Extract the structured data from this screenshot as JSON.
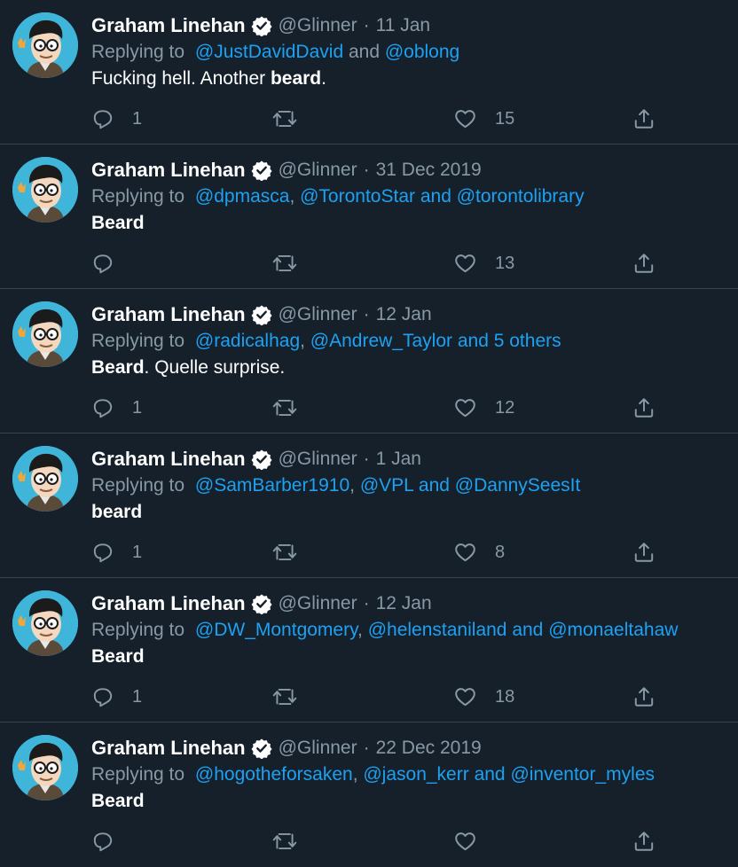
{
  "tweets": [
    {
      "name": "Graham Linehan",
      "handle": "@Glinner",
      "separator": "·",
      "date": "11 Jan",
      "replying_prefix": "Replying to",
      "replying_parts": [
        {
          "t": "@JustDavidDavid",
          "link": true
        },
        {
          "t": " and ",
          "link": false
        },
        {
          "t": "@oblong",
          "link": true
        }
      ],
      "text_parts": [
        {
          "t": "Fucking hell. Another ",
          "bold": false
        },
        {
          "t": "beard",
          "bold": true
        },
        {
          "t": ".",
          "bold": false
        }
      ],
      "replies": "1",
      "retweets": "",
      "likes": "15"
    },
    {
      "name": "Graham Linehan",
      "handle": "@Glinner",
      "separator": "·",
      "date": "31 Dec 2019",
      "replying_prefix": "Replying to",
      "replying_parts": [
        {
          "t": "@dpmasca",
          "link": true
        },
        {
          "t": ", ",
          "link": false
        },
        {
          "t": "@TorontoStar",
          "link": true
        },
        {
          "t": " and ",
          "link": true
        },
        {
          "t": "@torontolibrary",
          "link": true
        }
      ],
      "text_parts": [
        {
          "t": "Beard",
          "bold": true
        }
      ],
      "replies": "",
      "retweets": "",
      "likes": "13"
    },
    {
      "name": "Graham Linehan",
      "handle": "@Glinner",
      "separator": "·",
      "date": "12 Jan",
      "replying_prefix": "Replying to",
      "replying_parts": [
        {
          "t": "@radicalhag",
          "link": true
        },
        {
          "t": ", ",
          "link": false
        },
        {
          "t": "@Andrew_Taylor",
          "link": true
        },
        {
          "t": " and ",
          "link": true
        },
        {
          "t": "5 others",
          "link": true
        }
      ],
      "text_parts": [
        {
          "t": "Beard",
          "bold": true
        },
        {
          "t": ". Quelle surprise.",
          "bold": false
        }
      ],
      "replies": "1",
      "retweets": "",
      "likes": "12"
    },
    {
      "name": "Graham Linehan",
      "handle": "@Glinner",
      "separator": "·",
      "date": "1 Jan",
      "replying_prefix": "Replying to",
      "replying_parts": [
        {
          "t": "@SamBarber1910",
          "link": true
        },
        {
          "t": ", ",
          "link": false
        },
        {
          "t": "@VPL",
          "link": true
        },
        {
          "t": " and ",
          "link": true
        },
        {
          "t": "@DannySeesIt",
          "link": true
        }
      ],
      "text_parts": [
        {
          "t": "beard",
          "bold": true
        }
      ],
      "replies": "1",
      "retweets": "",
      "likes": "8"
    },
    {
      "name": "Graham Linehan",
      "handle": "@Glinner",
      "separator": "·",
      "date": "12 Jan",
      "replying_prefix": "Replying to",
      "replying_parts": [
        {
          "t": "@DW_Montgomery",
          "link": true
        },
        {
          "t": ", ",
          "link": false
        },
        {
          "t": "@helenstaniland",
          "link": true
        },
        {
          "t": " and ",
          "link": true
        },
        {
          "t": "@monaeltahaw",
          "link": true
        }
      ],
      "text_parts": [
        {
          "t": "Beard",
          "bold": true
        }
      ],
      "replies": "1",
      "retweets": "",
      "likes": "18"
    },
    {
      "name": "Graham Linehan",
      "handle": "@Glinner",
      "separator": "·",
      "date": "22 Dec 2019",
      "replying_prefix": "Replying to",
      "replying_parts": [
        {
          "t": "@hogotheforsaken",
          "link": true
        },
        {
          "t": ", ",
          "link": false
        },
        {
          "t": "@jason_kerr",
          "link": true
        },
        {
          "t": " and ",
          "link": true
        },
        {
          "t": "@inventor_myles",
          "link": true
        }
      ],
      "text_parts": [
        {
          "t": "Beard",
          "bold": true
        }
      ],
      "replies": "",
      "retweets": "",
      "likes": ""
    }
  ],
  "icons": {
    "reply": "reply-icon",
    "retweet": "retweet-icon",
    "like": "heart-icon",
    "share": "share-icon",
    "verified": "verified-badge-icon"
  },
  "colors": {
    "background": "#15202b",
    "divider": "#38444d",
    "text": "#ffffff",
    "muted": "#8899a6",
    "link": "#1da1f2"
  }
}
